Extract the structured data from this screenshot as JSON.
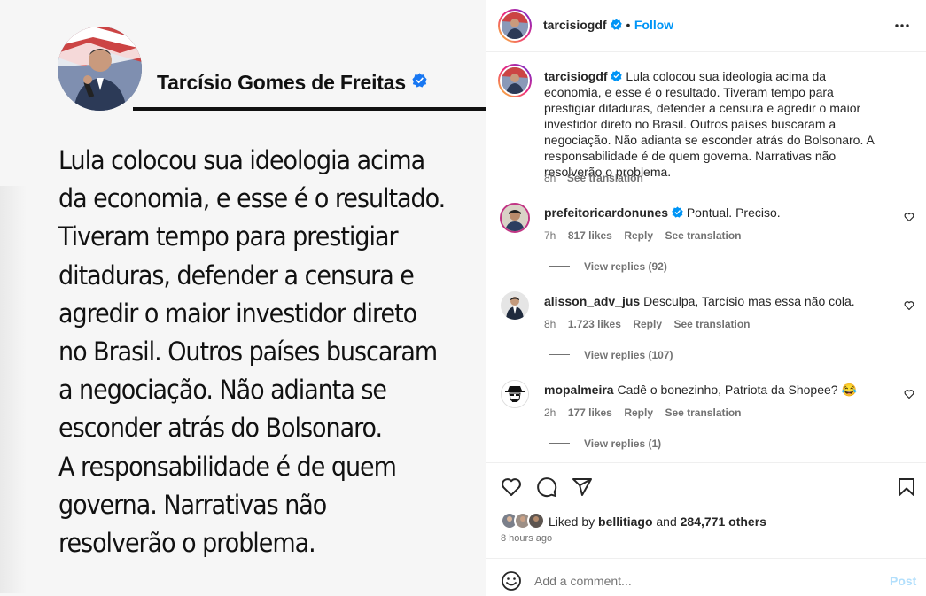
{
  "post_image": {
    "author_name": "Tarcísio Gomes de Freitas",
    "text": "Lula colocou sua ideologia acima\nda economia, e esse é o resultado.\nTiveram tempo para prestigiar\nditaduras, defender a censura e\nagredir o maior investidor direto\nno Brasil. Outros países buscaram\na negociação. Não adianta se\nesconder atrás do Bolsonaro.\nA responsabilidade é de quem\ngoverna. Narrativas não\nresolverão o problema."
  },
  "header": {
    "username": "tarcisiogdf",
    "separator": "•",
    "follow_label": "Follow"
  },
  "caption": {
    "username": "tarcisiogdf",
    "text": "Lula colocou sua ideologia acima da economia, e esse é o resultado. Tiveram tempo para prestigiar ditaduras, defender a censura e agredir o maior investidor direto no Brasil. Outros países buscaram a negociação. Não adianta se esconder atrás do Bolsonaro. A responsabilidade é de quem governa. Narrativas não resolverão o problema.",
    "time": "8h",
    "see_translation": "See translation"
  },
  "comments": [
    {
      "username": "prefeitoricardonunes",
      "verified": true,
      "text": "Pontual. Preciso.",
      "time": "7h",
      "likes": "817 likes",
      "reply": "Reply",
      "see_translation": "See translation",
      "view_replies": "View replies (92)"
    },
    {
      "username": "alisson_adv_jus",
      "verified": false,
      "text": "Desculpa, Tarcísio mas essa não cola.",
      "time": "8h",
      "likes": "1.723 likes",
      "reply": "Reply",
      "see_translation": "See translation",
      "view_replies": "View replies (107)"
    },
    {
      "username": "mopalmeira",
      "verified": false,
      "text": "Cadê o bonezinho, Patriota da Shopee? 😂",
      "time": "2h",
      "likes": "177 likes",
      "reply": "Reply",
      "see_translation": "See translation",
      "view_replies": "View replies (1)"
    }
  ],
  "likes": {
    "prefix": "Liked by",
    "user": "bellitiago",
    "and": "and",
    "others": "284,771 others"
  },
  "timestamp": "8 hours ago",
  "comment_box": {
    "placeholder": "Add a comment...",
    "post_label": "Post"
  },
  "colors": {
    "accent": "#0095f6",
    "verified": "#0095f6",
    "muted": "#737373"
  },
  "icons": [
    "more-icon",
    "heart-icon",
    "comment-icon",
    "share-icon",
    "bookmark-icon",
    "emoji-icon",
    "verified-icon"
  ]
}
